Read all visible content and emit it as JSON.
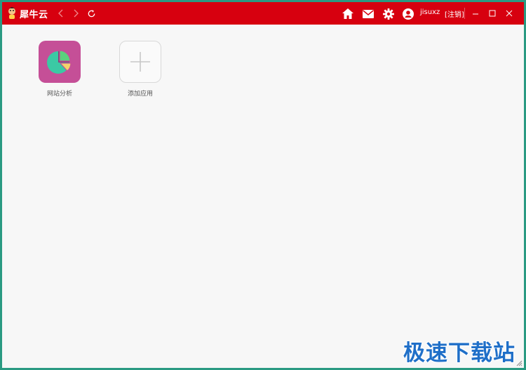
{
  "titlebar": {
    "logo_text": "犀牛云",
    "username": "jisuxz",
    "logout_label": "[注销]",
    "color": "#d7000f",
    "icons": {
      "back": "chevron-left-icon",
      "forward": "chevron-right-icon",
      "refresh": "refresh-icon",
      "home": "home-icon",
      "mail": "mail-icon",
      "settings": "gear-icon",
      "user": "user-icon",
      "minimize": "minimize-icon",
      "maximize": "maximize-icon",
      "close": "close-icon"
    }
  },
  "apps": [
    {
      "label": "网站分析",
      "icon": "pie-chart-icon",
      "color": "#c54f97"
    },
    {
      "label": "添加应用",
      "icon": "plus-icon"
    }
  ],
  "watermark": "极速下载站"
}
